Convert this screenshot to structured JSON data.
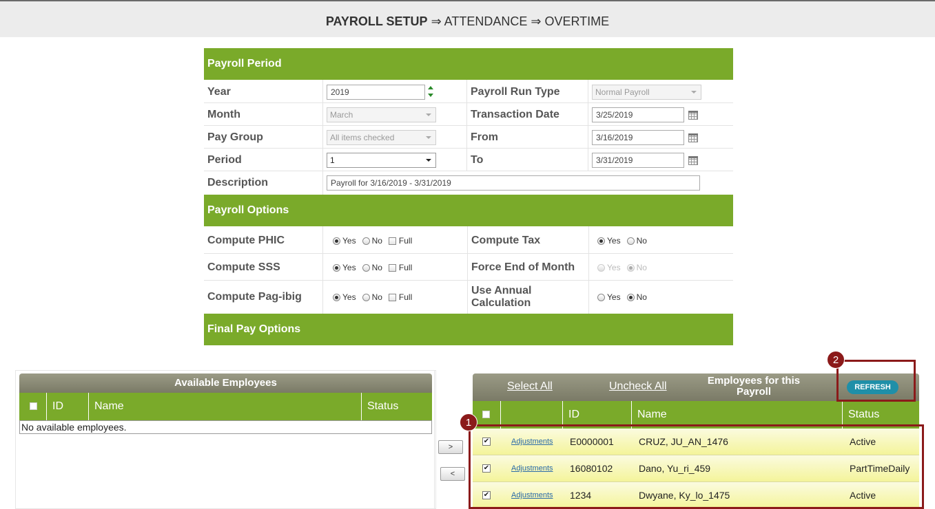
{
  "breadcrumb": {
    "part1": "PAYROLL SETUP",
    "sep1": " ⇒ ",
    "part2": "ATTENDANCE",
    "sep2": " ⇒ ",
    "part3": "OVERTIME"
  },
  "period_section": {
    "title": "Payroll Period",
    "year_label": "Year",
    "year_value": "2019",
    "run_type_label": "Payroll Run Type",
    "run_type_value": "Normal Payroll",
    "month_label": "Month",
    "month_value": "March",
    "trans_date_label": "Transaction Date",
    "trans_date_value": "3/25/2019",
    "pay_group_label": "Pay Group",
    "pay_group_value": "All items checked",
    "from_label": "From",
    "from_value": "3/16/2019",
    "period_label": "Period",
    "period_value": "1",
    "to_label": "To",
    "to_value": "3/31/2019",
    "description_label": "Description",
    "description_value": "Payroll for 3/16/2019 - 3/31/2019"
  },
  "options_section": {
    "title": "Payroll Options",
    "phic_label": "Compute PHIC",
    "sss_label": "Compute SSS",
    "pagibig_label": "Compute Pag-ibig",
    "tax_label": "Compute Tax",
    "eom_label": "Force End of Month",
    "annual_label_1": "Use Annual",
    "annual_label_2": "Calculation",
    "yes": "Yes",
    "no": "No",
    "full": "Full"
  },
  "final_pay_section": {
    "title": "Final Pay Options"
  },
  "available": {
    "title": "Available Employees",
    "col_id": "ID",
    "col_name": "Name",
    "col_status": "Status",
    "empty_text": "No available employees."
  },
  "move": {
    "right": ">",
    "left": "<"
  },
  "selected": {
    "select_all": "Select All",
    "uncheck_all": "Uncheck All",
    "title_1": "Employees for this",
    "title_2": "Payroll",
    "refresh": "REFRESH",
    "col_id": "ID",
    "col_name": "Name",
    "col_status": "Status",
    "rows": [
      {
        "link": "Adjustments",
        "id": "E0000001",
        "name": "CRUZ, JU_AN_1476",
        "status": "Active"
      },
      {
        "link": "Adjustments",
        "id": "16080102",
        "name": "Dano, Yu_ri_459",
        "status": "PartTimeDaily"
      },
      {
        "link": "Adjustments",
        "id": "1234",
        "name": "Dwyane, Ky_lo_1475",
        "status": "Active"
      }
    ]
  },
  "annotations": {
    "badge1": "1",
    "badge2": "2"
  },
  "colors": {
    "section_green": "#7aaa2a",
    "annotation_red": "#8b1a1a",
    "refresh_teal": "#1f8fa8"
  }
}
